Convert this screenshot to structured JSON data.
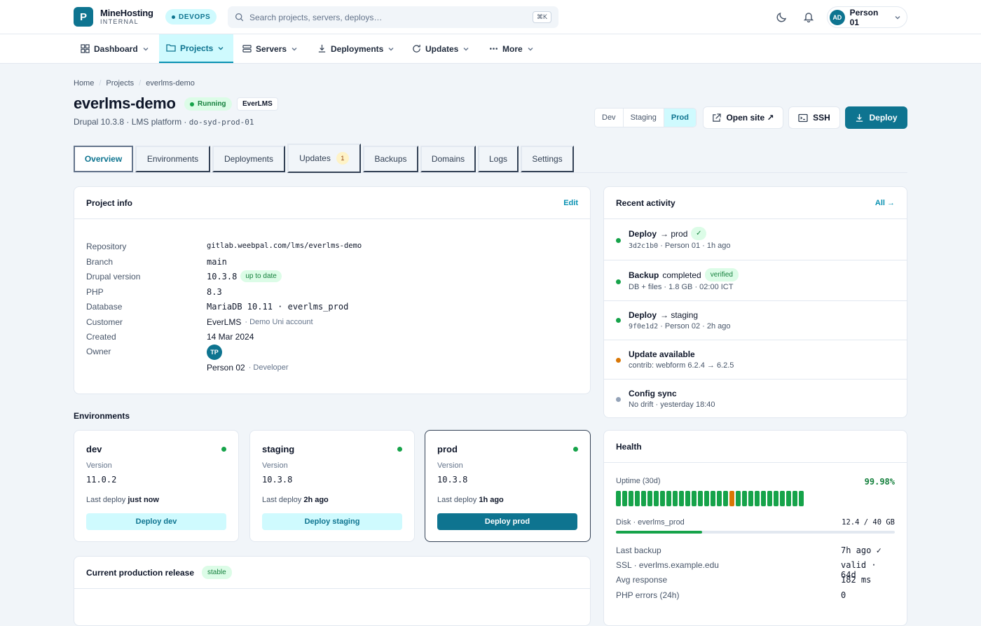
{
  "app": {
    "logo_letter": "P",
    "brand_name": "MineHosting",
    "brand_sub": "INTERNAL",
    "env_badge": "DEVOPS"
  },
  "search": {
    "placeholder": "Search projects, servers, deploys…",
    "shortcut": "⌘K"
  },
  "user": {
    "initials": "AD",
    "name": "Person 01"
  },
  "nav": [
    {
      "label": "Dashboard",
      "icon": "grid-icon"
    },
    {
      "label": "Projects",
      "icon": "folder-icon",
      "active": true
    },
    {
      "label": "Servers",
      "icon": "server-icon"
    },
    {
      "label": "Deployments",
      "icon": "download-icon"
    },
    {
      "label": "Updates",
      "icon": "refresh-icon"
    },
    {
      "label": "More",
      "icon": "more-icon"
    }
  ],
  "breadcrumb": [
    "Home",
    "Projects",
    "everlms-demo"
  ],
  "project": {
    "title": "everlms-demo",
    "status": "Running",
    "client_tag": "EverLMS",
    "subline_text": "Drupal 10.3.8 · LMS platform · ",
    "subline_host": "do-syd-prod-01"
  },
  "env_switch": [
    "Dev",
    "Staging",
    "Prod"
  ],
  "env_switch_active": "Prod",
  "actions": {
    "open_site": "Open site ↗",
    "ssh": "SSH",
    "deploy": "Deploy"
  },
  "tabs": [
    {
      "label": "Overview",
      "active": true
    },
    {
      "label": "Environments"
    },
    {
      "label": "Deployments"
    },
    {
      "label": "Updates",
      "count": "1"
    },
    {
      "label": "Backups"
    },
    {
      "label": "Domains"
    },
    {
      "label": "Logs"
    },
    {
      "label": "Settings"
    }
  ],
  "project_info": {
    "title": "Project info",
    "edit": "Edit",
    "rows": {
      "repository": {
        "label": "Repository",
        "value": "gitlab.weebpal.com/lms/everlms-demo"
      },
      "branch": {
        "label": "Branch",
        "value": "main"
      },
      "drupal": {
        "label": "Drupal version",
        "value": "10.3.8",
        "badge": "up to date"
      },
      "php": {
        "label": "PHP",
        "value": "8.3"
      },
      "database": {
        "label": "Database",
        "value": "MariaDB 10.11 · everlms_prod"
      },
      "customer": {
        "label": "Customer",
        "value": "EverLMS",
        "note": "· Demo Uni account"
      },
      "created": {
        "label": "Created",
        "value": "14 Mar 2024"
      },
      "owner": {
        "label": "Owner",
        "initials": "TP",
        "name": "Person 02",
        "role": "· Developer"
      }
    }
  },
  "environments": {
    "title": "Environments",
    "version_label": "Version",
    "last_deploy_label": "Last deploy",
    "items": [
      {
        "name": "dev",
        "version": "11.0.2",
        "last": "just now",
        "button": "Deploy dev"
      },
      {
        "name": "staging",
        "version": "10.3.8",
        "last": "2h ago",
        "button": "Deploy staging"
      },
      {
        "name": "prod",
        "version": "10.3.8",
        "last": "1h ago",
        "button": "Deploy prod"
      }
    ]
  },
  "release": {
    "title": "Current production release",
    "badge": "stable"
  },
  "activity": {
    "title": "Recent activity",
    "all": "All →",
    "items": [
      {
        "bold": "Deploy",
        "rest": "→ prod",
        "badge": "✓",
        "sub_mono": "3d2c1b0",
        "sub": " · Person 01 · 1h ago",
        "color": "#16a34a"
      },
      {
        "bold": "Backup",
        "rest": "completed",
        "badge": "verified",
        "sub": "DB + files · 1.8 GB · 02:00 ICT",
        "color": "#16a34a"
      },
      {
        "bold": "Deploy",
        "rest": "→ staging",
        "sub_mono": "9f0e1d2",
        "sub": " · Person 02 · 2h ago",
        "color": "#16a34a"
      },
      {
        "bold": "Update available",
        "rest": "",
        "sub": "contrib: webform 6.2.4 → 6.2.5",
        "color": "#d97706"
      },
      {
        "bold": "Config sync",
        "rest": "",
        "sub": "No drift · yesterday 18:40",
        "color": "#94a3b8"
      }
    ]
  },
  "health": {
    "title": "Health",
    "uptime_label": "Uptime (30d)",
    "uptime_value": "99.98%",
    "uptime_days": 30,
    "uptime_incident_day": 18,
    "colors": {
      "ok": "#16a34a",
      "incident": "#d97706"
    },
    "disk_label": "Disk · everlms_prod",
    "disk_value": "12.4 / 40 GB",
    "disk_fraction": 0.31,
    "rows": [
      {
        "label": "Last backup",
        "value": "7h ago ✓"
      },
      {
        "label": "SSL · everlms.example.edu",
        "value": "valid · 64d"
      },
      {
        "label": "Avg response",
        "value": "182 ms"
      },
      {
        "label": "PHP errors (24h)",
        "value": "0"
      }
    ]
  }
}
